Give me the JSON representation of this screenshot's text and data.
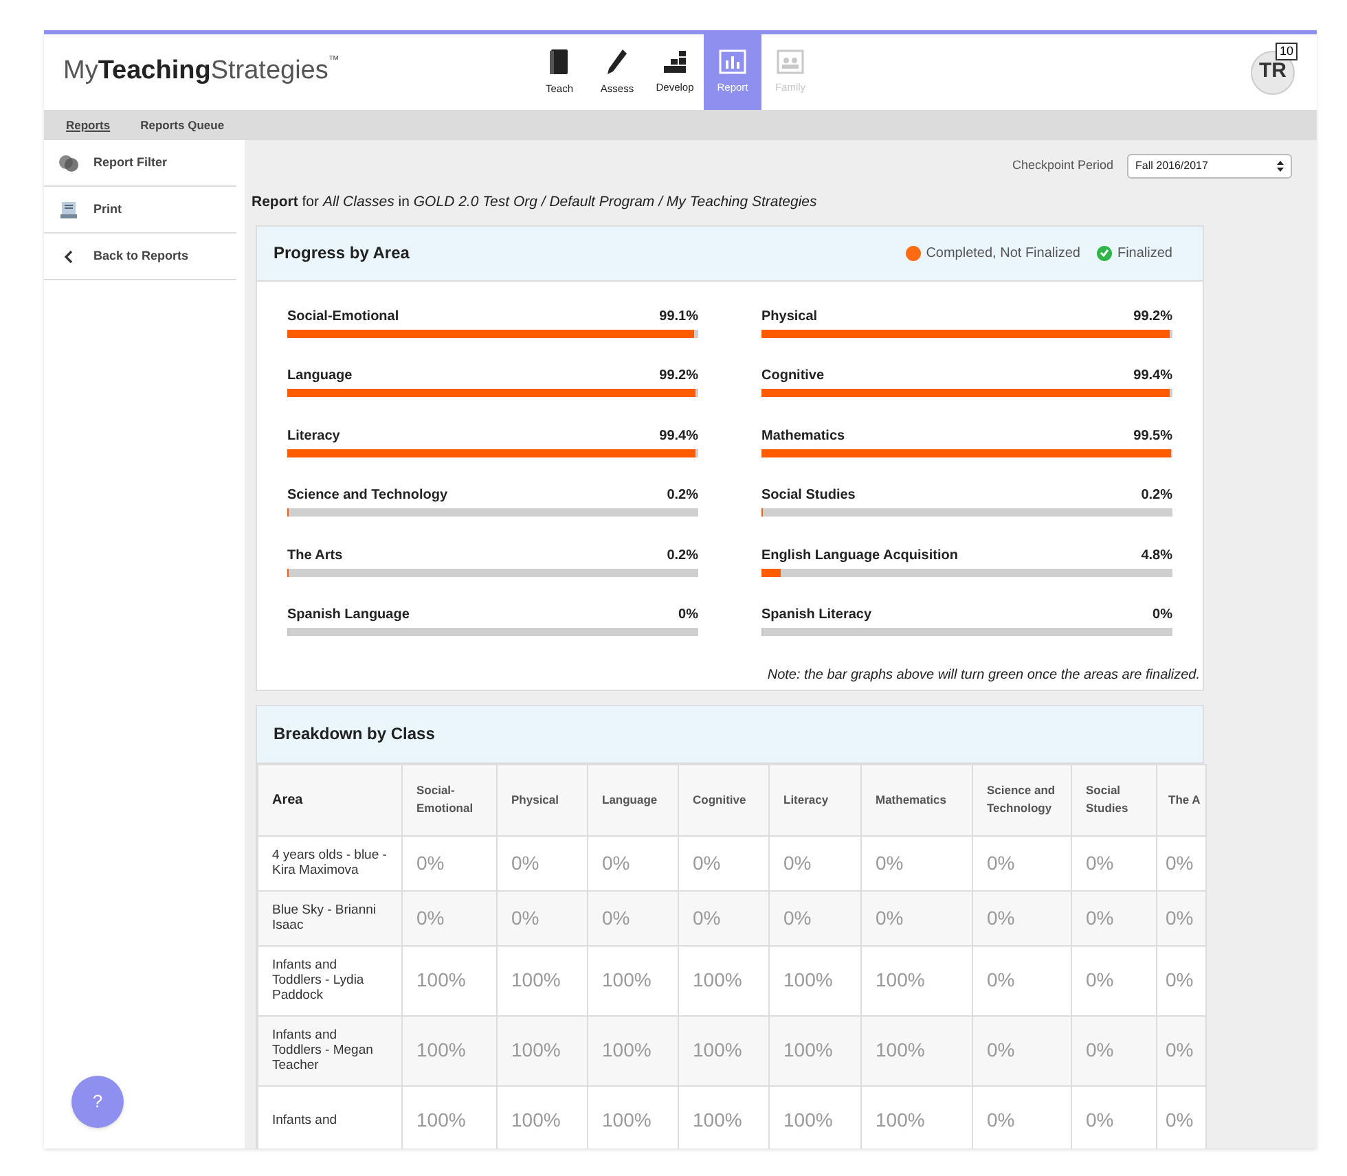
{
  "logo": {
    "light": "My",
    "bold": "Teaching",
    "rest": "Strategies",
    "mark": "™"
  },
  "nav": [
    {
      "label": "Teach",
      "selected": false,
      "disabled": false
    },
    {
      "label": "Assess",
      "selected": false,
      "disabled": false
    },
    {
      "label": "Develop",
      "selected": false,
      "disabled": false
    },
    {
      "label": "Report",
      "selected": true,
      "disabled": false
    },
    {
      "label": "Family",
      "selected": false,
      "disabled": true
    }
  ],
  "avatar": {
    "initials": "TR",
    "badge": "10"
  },
  "subnav": [
    {
      "label": "Reports",
      "selected": true
    },
    {
      "label": "Reports Queue",
      "selected": false
    }
  ],
  "sidebar": [
    {
      "label": "Report Filter"
    },
    {
      "label": "Print"
    },
    {
      "label": "Back to Reports"
    }
  ],
  "checkpoint": {
    "label": "Checkpoint Period",
    "value": "Fall 2016/2017"
  },
  "report_line": "**Report** for *All Classes* in *GOLD 2.0 Test Org / Default Program / My Teaching Strategies*",
  "progress": {
    "title": "Progress by Area",
    "legend": [
      {
        "label": "Completed, Not Finalized",
        "kind": "dot",
        "color": "#ff6a13"
      },
      {
        "label": "Finalized",
        "kind": "check",
        "color": "#2fb54a"
      }
    ],
    "areas": [
      {
        "name": "Social-Emotional",
        "value": "99.1%",
        "level": 0.991
      },
      {
        "name": "Physical",
        "value": "99.2%",
        "level": 0.992
      },
      {
        "name": "Language",
        "value": "99.2%",
        "level": 0.992
      },
      {
        "name": "Cognitive",
        "value": "99.4%",
        "level": 0.994
      },
      {
        "name": "Literacy",
        "value": "99.4%",
        "level": 0.994
      },
      {
        "name": "Mathematics",
        "value": "99.5%",
        "level": 0.995
      },
      {
        "name": "Science and Technology",
        "value": "0.2%",
        "level": 0.002
      },
      {
        "name": "Social Studies",
        "value": "0.2%",
        "level": 0.002
      },
      {
        "name": "The Arts",
        "value": "0.2%",
        "level": 0.002
      },
      {
        "name": "English Language Acquisition",
        "value": "4.8%",
        "level": 0.048
      },
      {
        "name": "Spanish Language",
        "value": "0%",
        "level": 0
      },
      {
        "name": "Spanish Literacy",
        "value": "0%",
        "level": 0
      }
    ],
    "note": "Note: the bar graphs above will turn green once the areas are finalized."
  },
  "breakdown": {
    "title": "Breakdown by Class",
    "columns": [
      "Area",
      "Social-Emotional",
      "Physical",
      "Language",
      "Cognitive",
      "Literacy",
      "Mathematics",
      "Science and Technology",
      "Social Studies",
      "The A"
    ],
    "rows": [
      [
        "4 years olds - blue - Kira Maximova",
        "0%",
        "0%",
        "0%",
        "0%",
        "0%",
        "0%",
        "0%",
        "0%",
        "0%"
      ],
      [
        "Blue Sky - Brianni Isaac",
        "0%",
        "0%",
        "0%",
        "0%",
        "0%",
        "0%",
        "0%",
        "0%",
        "0%"
      ],
      [
        "Infants and Toddlers - Lydia Paddock",
        "100%",
        "100%",
        "100%",
        "100%",
        "100%",
        "100%",
        "0%",
        "0%",
        "0%"
      ],
      [
        "Infants and Toddlers - Megan Teacher",
        "100%",
        "100%",
        "100%",
        "100%",
        "100%",
        "100%",
        "0%",
        "0%",
        "0%"
      ],
      [
        "Infants and",
        "100%",
        "100%",
        "100%",
        "100%",
        "100%",
        "100%",
        "0%",
        "0%",
        "0%"
      ]
    ]
  },
  "help": {
    "label": "?"
  }
}
